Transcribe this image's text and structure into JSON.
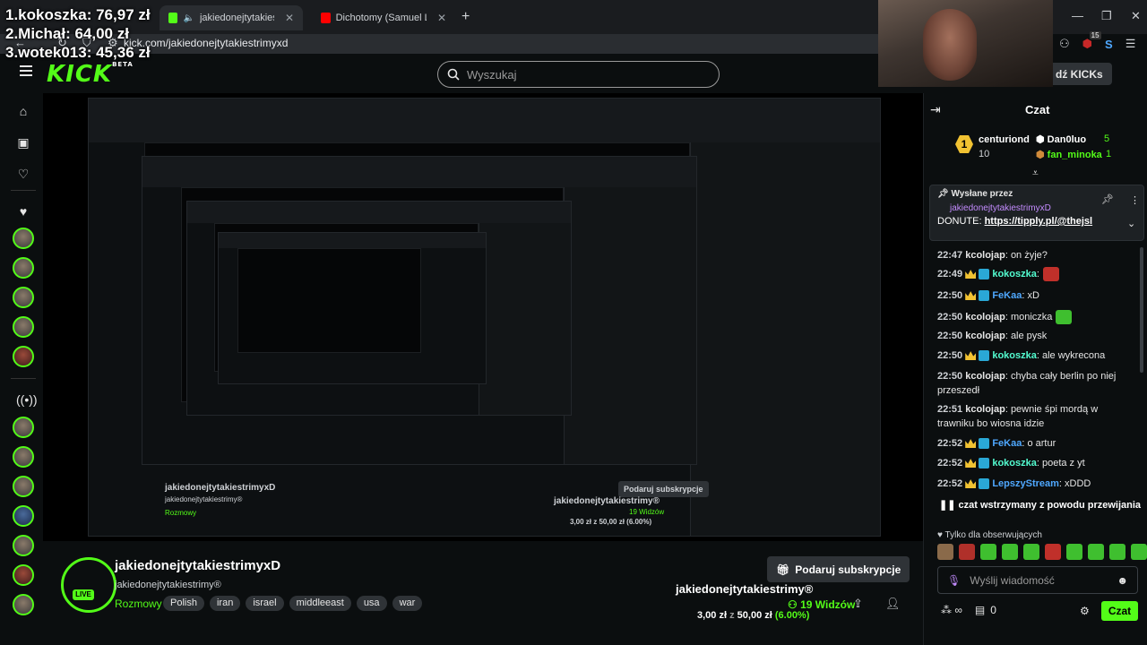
{
  "overlay": {
    "donations": [
      "1.kokoszka: 76,97 zł",
      "2.Michał: 64,00 zł",
      "3.wotek013: 45,36 zł"
    ]
  },
  "browser": {
    "tabs": [
      {
        "label": "jakiedonejtytakiestrimyxD",
        "favicon_color": "#53fc18"
      },
      {
        "label": "Dichotomy (Samuel L Session M",
        "favicon_color": "#ff0000"
      }
    ],
    "url": "kick.com/jakiedonejtytakiestrimyxd",
    "ext_badge": "15"
  },
  "header": {
    "logo": "KICK",
    "logo_sup": "BETA",
    "search_placeholder": "Wyszukaj",
    "kicks_label": "dź KICKs"
  },
  "stream": {
    "nested_caption": "jakiedonejtytakiestrimyxD",
    "nested_sub": "jakiedonejtytakiestrimy®",
    "nested_cat": "Rozmowy",
    "nested_gift": "Podaruj subskrypcje",
    "nested_title": "jakiedonejtytakiestrimy®",
    "nested_viewers": "19 Widzów",
    "nested_goal": "3,00 zł z 50,00 zł (6.00%)"
  },
  "channel": {
    "name": "jakiedonejtytakiestrimyxD",
    "subtitle": "jakiedonejtytakiestrimy®",
    "category": "Rozmowy",
    "live": "LIVE",
    "tags": [
      "Polish",
      "iran",
      "israel",
      "middleeast",
      "usa",
      "war"
    ],
    "gift_label": "Podaruj subskrypcje",
    "title": "jakiedonejtytakiestrimy®",
    "viewers": "19 Widzów",
    "goal_amount": "3,00 zł",
    "goal_sep": "z",
    "goal_target": "50,00 zł",
    "goal_pct": "(6.00%)"
  },
  "chat": {
    "title": "Czat",
    "leaderboard": {
      "first": {
        "rank": "1",
        "name": "centuriond",
        "count": "10"
      },
      "second": {
        "name": "Dan0luo",
        "count": "5"
      },
      "third": {
        "name": "fan_minoka",
        "count": "1"
      }
    },
    "pinned": {
      "label": "Wysłane przez",
      "user": "jakiedonejtytakiestrimyxD",
      "text_prefix": "DONUTE:",
      "link": "https://tipply.pl/@thejsl"
    },
    "messages": [
      {
        "time": "22:47",
        "user": "kcolojap",
        "text": ": on żyje?"
      },
      {
        "time": "22:49",
        "user": "kokoszka",
        "text": ":"
      },
      {
        "time": "22:50",
        "user": "FeKaa",
        "text": ": xD"
      },
      {
        "time": "22:50",
        "user": "kcolojap",
        "text": ": moniczka"
      },
      {
        "time": "22:50",
        "user": "kcolojap",
        "text": ": ale pysk"
      },
      {
        "time": "22:50",
        "user": "kokoszka",
        "text": ": ale wykrecona"
      },
      {
        "time": "22:50",
        "user": "kcolojap",
        "text": ": chyba cały berlin po niej przeszedł"
      },
      {
        "time": "22:51",
        "user": "kcolojap",
        "text": ": pewnie śpi mordą w trawniku bo wiosna idzie"
      },
      {
        "time": "22:52",
        "user": "FeKaa",
        "text": ": o artur"
      },
      {
        "time": "22:52",
        "user": "kokoszka",
        "text": ": poeta z yt"
      },
      {
        "time": "22:52",
        "user": "LepszyStream",
        "text": ": xDDD"
      }
    ],
    "paused": "czat wstrzymany z powodu przewijania",
    "followers_only": "Tylko dla obserwujących",
    "input_placeholder": "Wyślij wiadomość",
    "points": "0",
    "send_label": "Czat"
  },
  "colors": {
    "accent": "#53fc18",
    "user_blue": "#4fa8ff",
    "user_teal": "#53fcd0",
    "user_plain": "#e6e6e6"
  }
}
